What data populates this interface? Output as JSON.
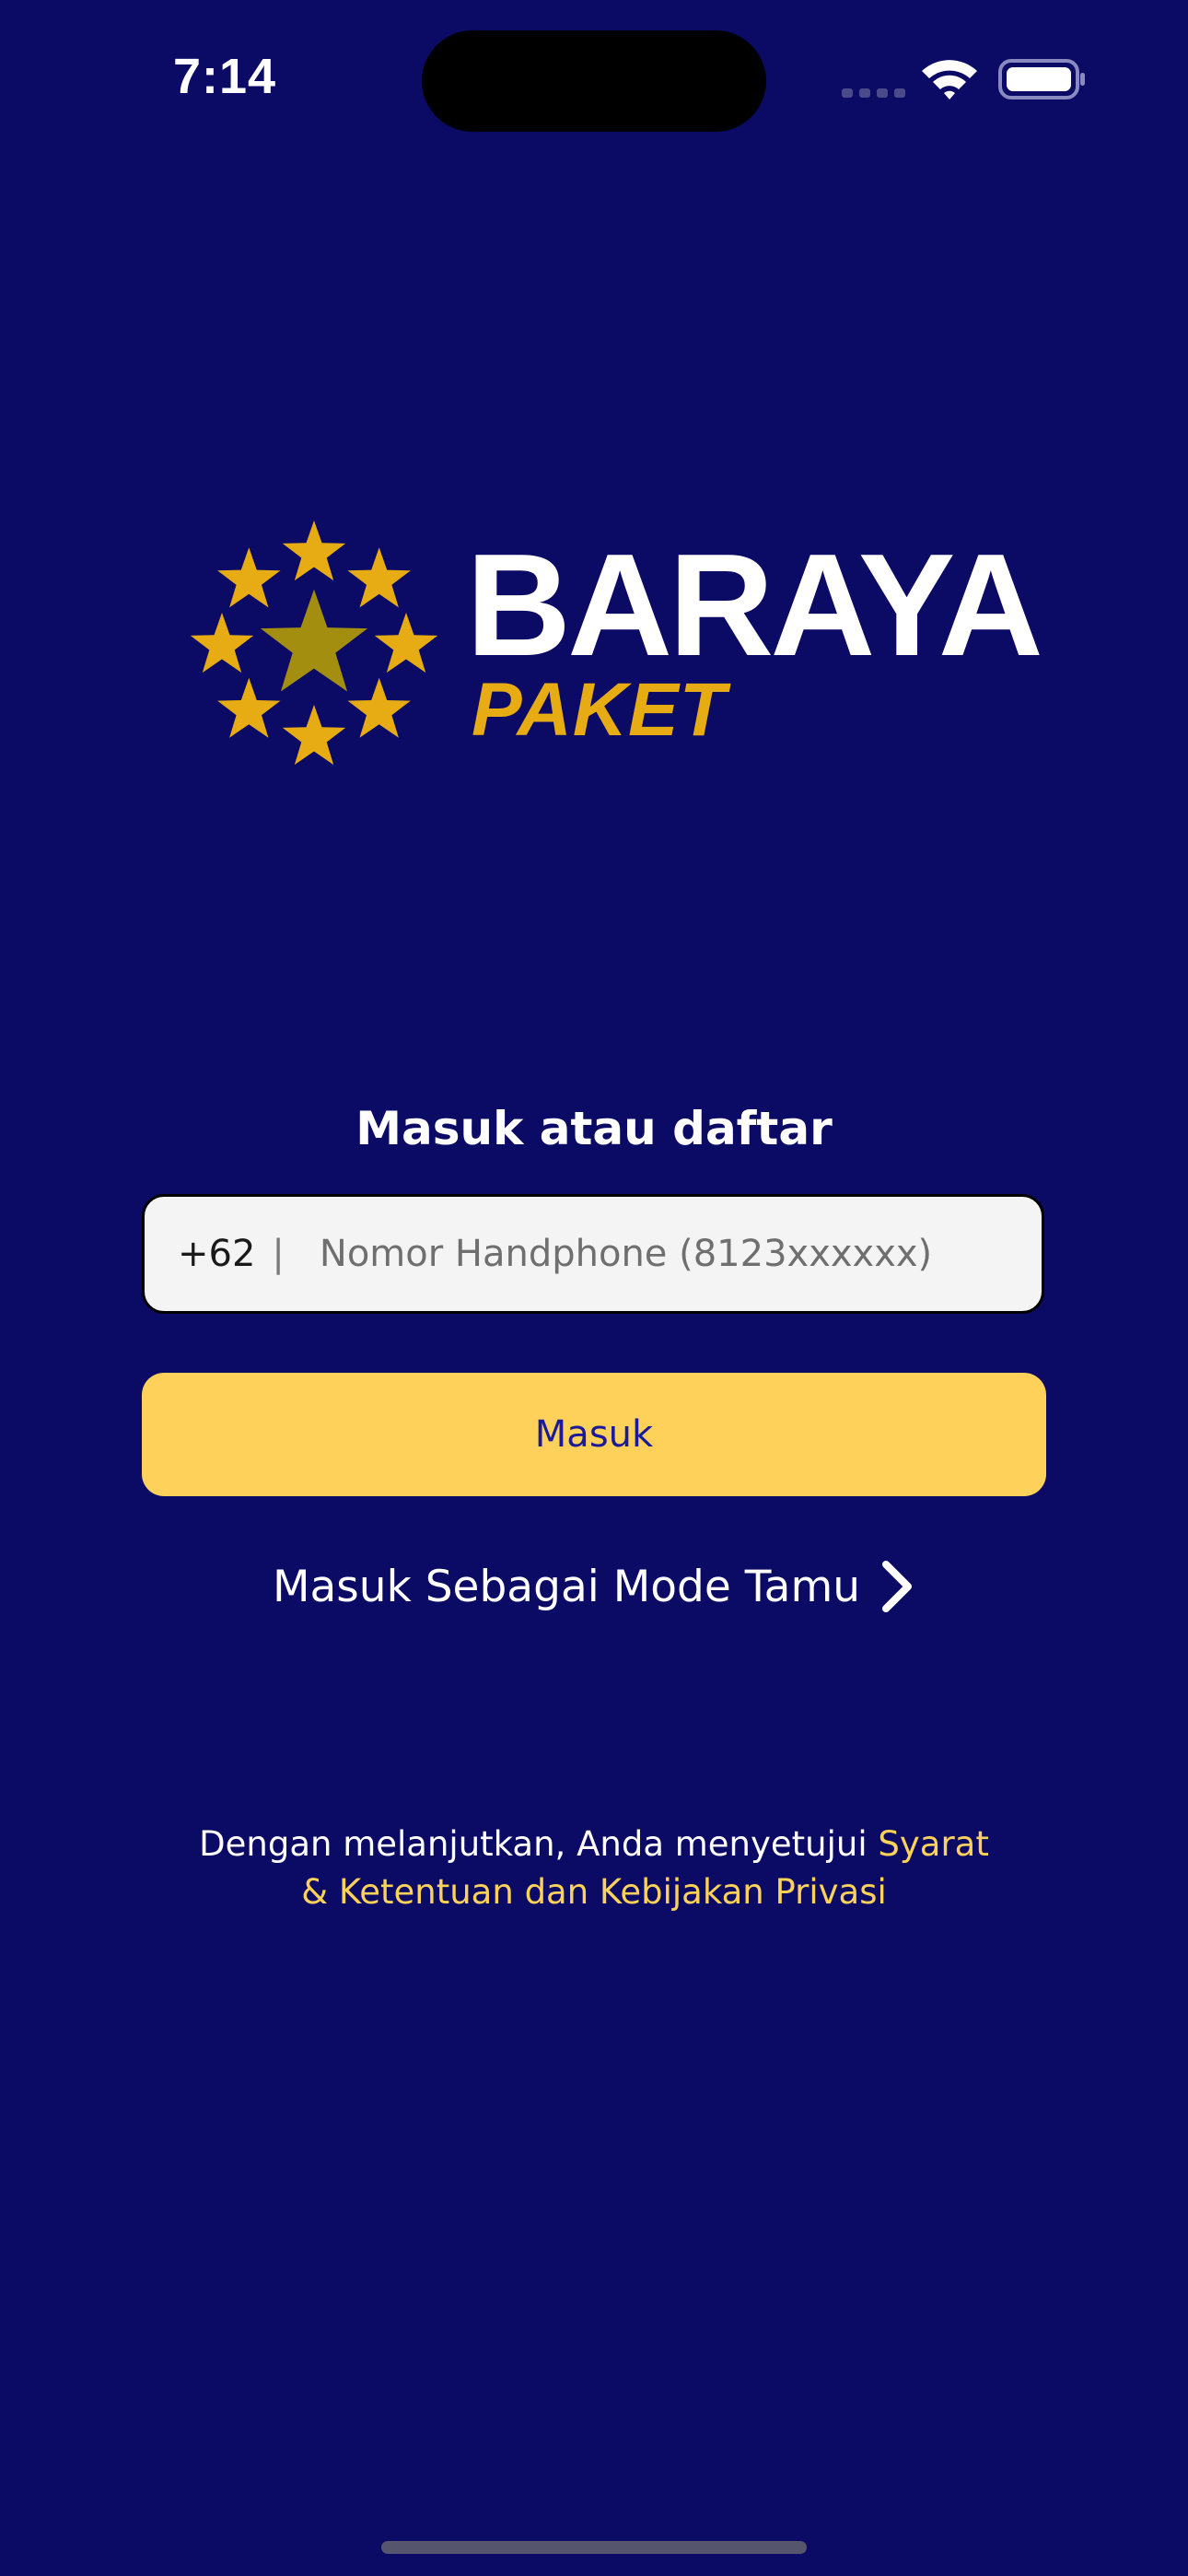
{
  "status_bar": {
    "time": "7:14"
  },
  "logo": {
    "brand": "BARAYA",
    "sub": "PAKET"
  },
  "form": {
    "title": "Masuk atau daftar",
    "phone_prefix": "+62",
    "phone_divider": "|",
    "phone_placeholder": "Nomor Handphone (8123xxxxxx)",
    "phone_value": "",
    "login_label": "Masuk",
    "guest_label": "Masuk Sebagai Mode Tamu"
  },
  "terms": {
    "text": "Dengan melanjutkan, Anda menyetujui ",
    "link": "Syarat & Ketentuan dan Kebijakan Privasi"
  },
  "colors": {
    "background": "#0b0b66",
    "accent": "#fed25a",
    "logo_gold": "#e7ac14",
    "button_text": "#1a1a9a"
  },
  "icons": {
    "wifi": "wifi-icon",
    "battery": "battery-icon",
    "signal": "cellular-signal-icon",
    "chevron": "chevron-right-icon",
    "logo_mark": "star-ring-logo-icon"
  }
}
